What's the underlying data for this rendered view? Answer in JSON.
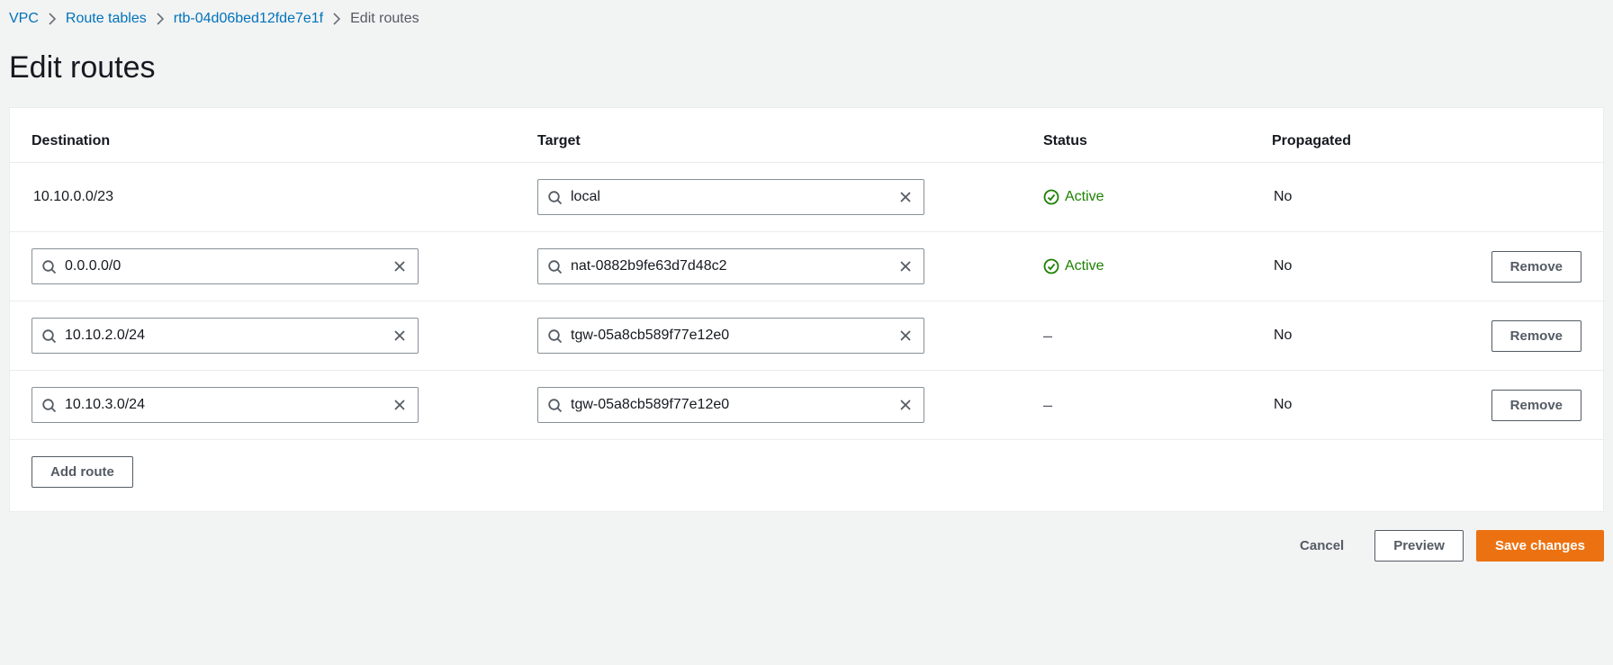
{
  "breadcrumb": {
    "vpc": "VPC",
    "route_tables": "Route tables",
    "rtb_id": "rtb-04d06bed12fde7e1f",
    "current": "Edit routes"
  },
  "page_title": "Edit routes",
  "headers": {
    "destination": "Destination",
    "target": "Target",
    "status": "Status",
    "propagated": "Propagated"
  },
  "status_labels": {
    "active": "Active",
    "none": "–"
  },
  "routes": [
    {
      "destination_text": "10.10.0.0/23",
      "destination_editable": false,
      "target": "local",
      "status": "active",
      "propagated": "No",
      "removable": false
    },
    {
      "destination_text": "0.0.0.0/0",
      "destination_editable": true,
      "target": "nat-0882b9fe63d7d48c2",
      "status": "active",
      "propagated": "No",
      "removable": true
    },
    {
      "destination_text": "10.10.2.0/24",
      "destination_editable": true,
      "target": "tgw-05a8cb589f77e12e0",
      "status": "none",
      "propagated": "No",
      "removable": true
    },
    {
      "destination_text": "10.10.3.0/24",
      "destination_editable": true,
      "target": "tgw-05a8cb589f77e12e0",
      "status": "none",
      "propagated": "No",
      "removable": true
    }
  ],
  "buttons": {
    "remove": "Remove",
    "add_route": "Add route",
    "cancel": "Cancel",
    "preview": "Preview",
    "save": "Save changes"
  }
}
